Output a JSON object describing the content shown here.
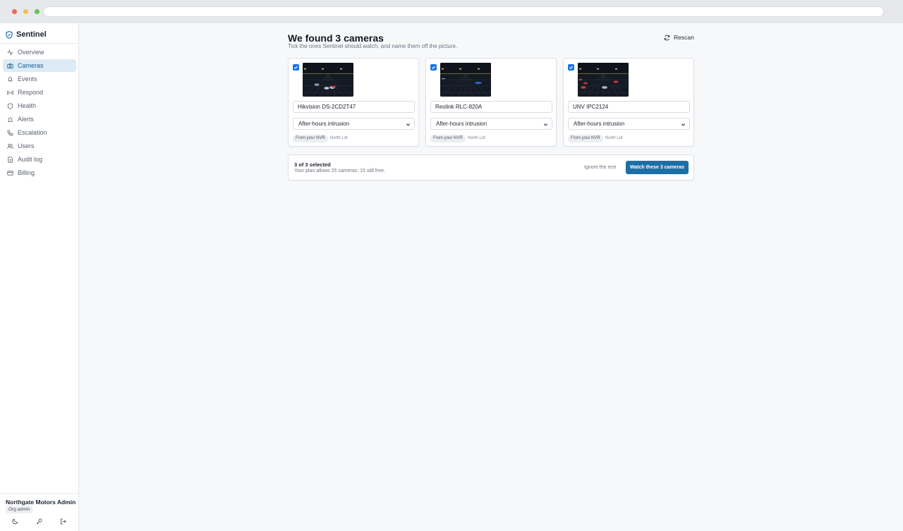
{
  "app": {
    "name": "Sentinel"
  },
  "nav": [
    {
      "label": "Overview",
      "icon": "activity-icon",
      "active": false
    },
    {
      "label": "Cameras",
      "icon": "camera-icon",
      "active": true
    },
    {
      "label": "Events",
      "icon": "bell-icon",
      "active": false
    },
    {
      "label": "Respond",
      "icon": "radio-icon",
      "active": false
    },
    {
      "label": "Health",
      "icon": "shield-icon",
      "active": false
    },
    {
      "label": "Alerts",
      "icon": "siren-icon",
      "active": false
    },
    {
      "label": "Escalation",
      "icon": "phone-icon",
      "active": false
    },
    {
      "label": "Users",
      "icon": "users-icon",
      "active": false
    },
    {
      "label": "Audit log",
      "icon": "document-icon",
      "active": false
    },
    {
      "label": "Billing",
      "icon": "card-icon",
      "active": false
    }
  ],
  "org": {
    "name": "Northgate Motors Admin",
    "role": "Org admin"
  },
  "page": {
    "title": "We found 3 cameras",
    "subtitle": "Tick the ones Sentinel should watch, and name them off the picture.",
    "rescan_label": "Rescan"
  },
  "cameras": [
    {
      "name": "Hikvision DS-2CD2T47",
      "profile": "After-hours intrusion",
      "source": "From your NVR",
      "site": "North Lot",
      "checked": true
    },
    {
      "name": "Reolink RLC-820A",
      "profile": "After-hours intrusion",
      "source": "From your NVR",
      "site": "North Lot",
      "checked": true
    },
    {
      "name": "UNV IPC2124",
      "profile": "After-hours intrusion",
      "source": "From your NVR",
      "site": "North Lot",
      "checked": true
    }
  ],
  "summary": {
    "count": "3 of 3 selected",
    "plan": "Your plan allows 25 cameras; 15 still free.",
    "ignore_label": "Ignore the rest",
    "watch_label": "Watch these 3 cameras"
  },
  "colors": {
    "accent": "#1d6fa5",
    "checkbox": "#1a73e8",
    "nav_active_bg": "#dcebf6"
  }
}
